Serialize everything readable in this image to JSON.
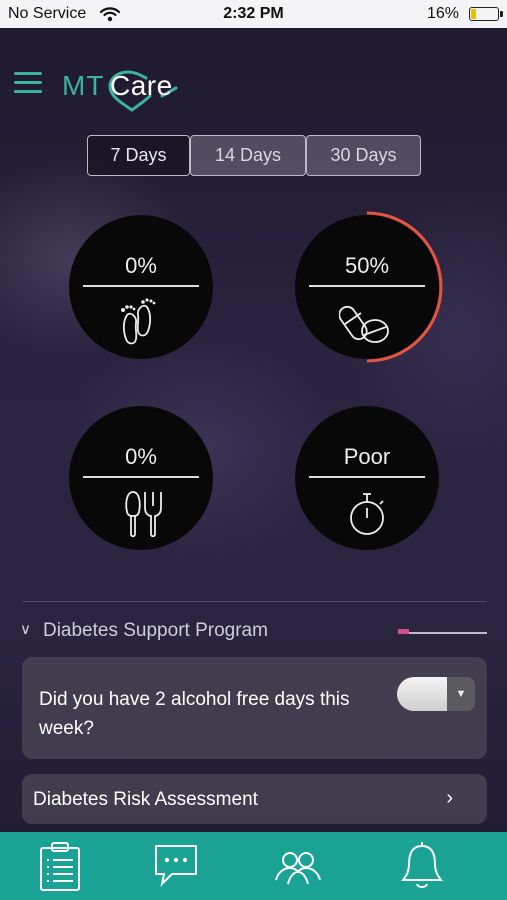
{
  "status_bar": {
    "carrier": "No Service",
    "time": "2:32 PM",
    "battery": "16%",
    "battery_fraction": 0.16
  },
  "header": {
    "logo_mt": "MT",
    "logo_care": "Care",
    "menu_icon": "hamburger-menu-icon"
  },
  "range_tabs": [
    {
      "label": "7 Days",
      "selected": true
    },
    {
      "label": "14 Days",
      "selected": false
    },
    {
      "label": "30 Days",
      "selected": false
    }
  ],
  "stats": [
    {
      "value": "0%",
      "icon": "footprints-icon"
    },
    {
      "value": "50%",
      "icon": "pills-icon",
      "progress": 0.5,
      "ring_color": "#e5543e"
    },
    {
      "value": "0%",
      "icon": "cutlery-icon"
    },
    {
      "value": "Poor",
      "icon": "stopwatch-icon"
    }
  ],
  "program": {
    "title": "Diabetes Support Program",
    "progress": 0.12,
    "progress_color": "#d2508a",
    "question": "Did you have 2 alcohol free days this week?",
    "risk_assessment": "Diabetes Risk Assessment",
    "arrow": "›"
  },
  "tab_bar": {
    "color": "#1aa394",
    "items": [
      "clipboard-icon",
      "chat-icon",
      "people-icon",
      "bell-icon"
    ]
  },
  "colors": {
    "accent": "#3bb3a3",
    "ring": "#e5543e"
  }
}
